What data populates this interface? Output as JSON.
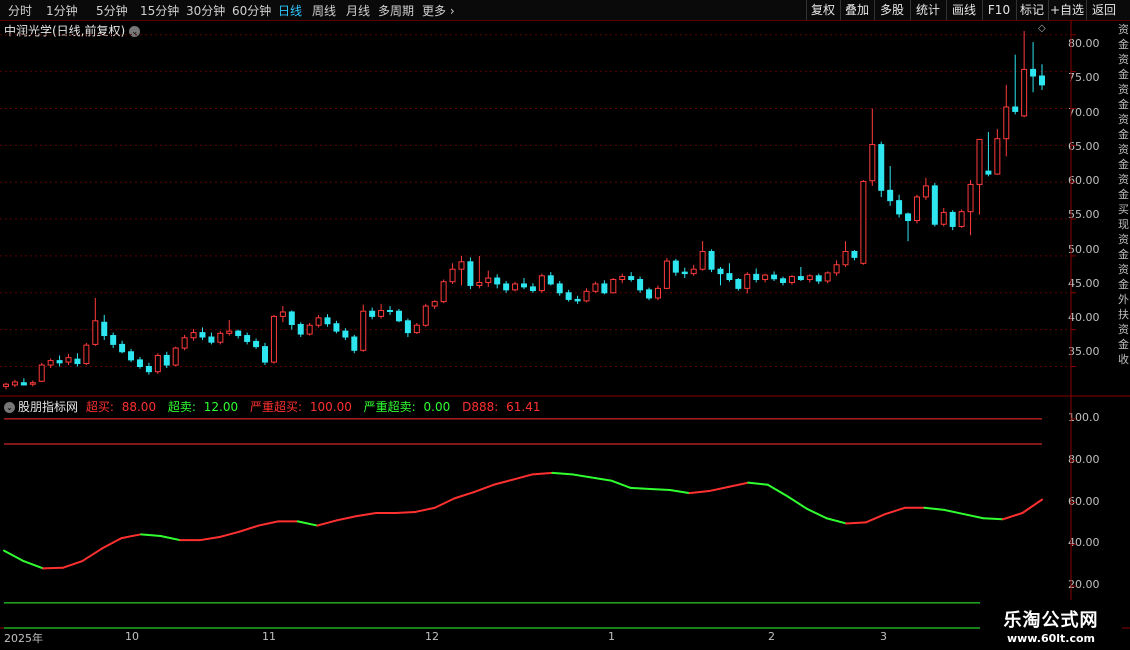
{
  "toolbar": {
    "timeframes": [
      "分时",
      "1分钟",
      "5分钟",
      "15分钟",
      "30分钟",
      "60分钟",
      "日线",
      "周线",
      "月线",
      "多周期",
      "更多"
    ],
    "active_timeframe": "日线",
    "buttons": [
      "复权",
      "叠加",
      "多股",
      "统计",
      "画线",
      "F10",
      "标记",
      "+自选",
      "返回"
    ]
  },
  "stock": {
    "title": "中润光学(日线,前复权)"
  },
  "price_axis": [
    "80.00",
    "75.00",
    "70.00",
    "65.00",
    "60.00",
    "55.00",
    "50.00",
    "45.00",
    "40.00",
    "35.00"
  ],
  "indicator": {
    "name": "股朋指标网",
    "legend": [
      {
        "label": "超买:",
        "value": "88.00",
        "color": "#ff3030"
      },
      {
        "label": "超卖:",
        "value": "12.00",
        "color": "#30ff30"
      },
      {
        "label": "严重超买:",
        "value": "100.00",
        "color": "#ff3030"
      },
      {
        "label": "严重超卖:",
        "value": "0.00",
        "color": "#30ff30"
      },
      {
        "label": "D888:",
        "value": "61.41",
        "color": "#ff3030"
      }
    ],
    "axis": [
      "100.0",
      "80.00",
      "60.00",
      "40.00",
      "20.00"
    ]
  },
  "dates": [
    "2025年",
    "10",
    "11",
    "12",
    "1",
    "2",
    "3"
  ],
  "side_strip": "资金资金资金资金资金资金买现资金资金外扶资金收",
  "watermark": {
    "line1": "乐淘公式网",
    "line2": "www.60lt.com"
  },
  "colors": {
    "up": "#ff3b3b",
    "down": "#2ee6f0",
    "overbought": "#ff3030",
    "oversold": "#30ff30"
  },
  "chart_data": [
    {
      "type": "candlestick",
      "title": "中润光学(日线,前复权)",
      "ylim": [
        31,
        82
      ],
      "candles": [
        [
          32.3,
          32.8,
          31.9,
          32.6
        ],
        [
          32.5,
          33.2,
          32.2,
          32.9
        ],
        [
          32.8,
          33.4,
          32.6,
          32.5
        ],
        [
          32.6,
          33.1,
          32.3,
          32.8
        ],
        [
          33.0,
          35.5,
          32.9,
          35.2
        ],
        [
          35.2,
          36.1,
          34.8,
          35.8
        ],
        [
          35.8,
          36.5,
          35.0,
          35.5
        ],
        [
          35.6,
          36.7,
          35.2,
          36.2
        ],
        [
          36.0,
          36.8,
          35.0,
          35.4
        ],
        [
          35.4,
          38.2,
          35.2,
          37.9
        ],
        [
          38.0,
          44.3,
          37.8,
          41.2
        ],
        [
          41.0,
          42.0,
          38.6,
          39.2
        ],
        [
          39.2,
          39.6,
          37.5,
          38.0
        ],
        [
          38.0,
          38.5,
          36.8,
          37.0
        ],
        [
          37.0,
          37.4,
          35.6,
          35.9
        ],
        [
          35.9,
          36.3,
          34.7,
          35.0
        ],
        [
          35.0,
          35.5,
          33.9,
          34.3
        ],
        [
          34.3,
          36.8,
          34.0,
          36.5
        ],
        [
          36.5,
          37.0,
          34.8,
          35.2
        ],
        [
          35.2,
          37.7,
          35.0,
          37.5
        ],
        [
          37.5,
          39.3,
          37.2,
          38.9
        ],
        [
          38.9,
          40.1,
          38.5,
          39.6
        ],
        [
          39.6,
          40.3,
          38.6,
          39.0
        ],
        [
          39.0,
          39.6,
          38.0,
          38.3
        ],
        [
          38.3,
          39.8,
          38.0,
          39.5
        ],
        [
          39.5,
          41.3,
          39.2,
          39.8
        ],
        [
          39.8,
          40.0,
          38.8,
          39.2
        ],
        [
          39.2,
          39.6,
          38.0,
          38.4
        ],
        [
          38.4,
          38.8,
          37.4,
          37.7
        ],
        [
          37.7,
          38.2,
          35.2,
          35.6
        ],
        [
          35.6,
          42.0,
          35.4,
          41.8
        ],
        [
          41.8,
          43.2,
          41.0,
          42.4
        ],
        [
          42.4,
          42.6,
          40.0,
          40.7
        ],
        [
          40.7,
          41.0,
          39.0,
          39.4
        ],
        [
          39.4,
          40.9,
          39.2,
          40.6
        ],
        [
          40.6,
          42.0,
          40.3,
          41.6
        ],
        [
          41.6,
          42.1,
          40.4,
          40.8
        ],
        [
          40.8,
          41.2,
          39.5,
          39.8
        ],
        [
          39.8,
          40.2,
          38.6,
          39.0
        ],
        [
          39.0,
          39.3,
          36.8,
          37.2
        ],
        [
          37.2,
          43.4,
          37.0,
          42.5
        ],
        [
          42.5,
          43.0,
          41.4,
          41.8
        ],
        [
          41.8,
          43.5,
          41.5,
          42.6
        ],
        [
          42.6,
          43.2,
          42.0,
          42.5
        ],
        [
          42.5,
          42.8,
          41.0,
          41.2
        ],
        [
          41.2,
          41.5,
          39.0,
          39.6
        ],
        [
          39.6,
          40.9,
          39.4,
          40.6
        ],
        [
          40.6,
          43.5,
          40.4,
          43.2
        ],
        [
          43.2,
          44.0,
          42.8,
          43.8
        ],
        [
          43.8,
          46.8,
          43.6,
          46.5
        ],
        [
          46.5,
          49.0,
          46.2,
          48.2
        ],
        [
          48.2,
          50.0,
          46.0,
          49.2
        ],
        [
          49.2,
          49.8,
          45.5,
          46.0
        ],
        [
          46.0,
          50.0,
          45.6,
          46.4
        ],
        [
          46.4,
          48.0,
          45.8,
          47.0
        ],
        [
          47.0,
          47.5,
          45.6,
          46.2
        ],
        [
          46.2,
          46.6,
          45.0,
          45.4
        ],
        [
          45.4,
          46.5,
          45.2,
          46.2
        ],
        [
          46.2,
          47.0,
          45.5,
          45.8
        ],
        [
          45.8,
          46.3,
          45.0,
          45.3
        ],
        [
          45.3,
          47.6,
          45.0,
          47.3
        ],
        [
          47.3,
          47.8,
          46.0,
          46.2
        ],
        [
          46.2,
          46.6,
          44.6,
          45.0
        ],
        [
          45.0,
          45.4,
          43.8,
          44.1
        ],
        [
          44.1,
          44.6,
          43.5,
          43.9
        ],
        [
          43.9,
          45.6,
          43.7,
          45.2
        ],
        [
          45.2,
          46.5,
          45.0,
          46.2
        ],
        [
          46.2,
          46.7,
          44.8,
          45.0
        ],
        [
          45.0,
          47.0,
          44.9,
          46.8
        ],
        [
          46.8,
          47.6,
          46.3,
          47.2
        ],
        [
          47.2,
          47.8,
          46.5,
          46.8
        ],
        [
          46.8,
          47.2,
          45.0,
          45.4
        ],
        [
          45.4,
          45.7,
          44.0,
          44.3
        ],
        [
          44.3,
          46.0,
          44.0,
          45.6
        ],
        [
          45.6,
          49.7,
          45.5,
          49.3
        ],
        [
          49.3,
          49.6,
          47.3,
          47.8
        ],
        [
          47.8,
          48.4,
          47.0,
          47.6
        ],
        [
          47.6,
          48.8,
          47.3,
          48.2
        ],
        [
          48.2,
          52.0,
          48.0,
          50.6
        ],
        [
          50.6,
          50.9,
          47.8,
          48.2
        ],
        [
          48.2,
          48.5,
          46.0,
          47.6
        ],
        [
          47.6,
          49.0,
          46.5,
          46.8
        ],
        [
          46.8,
          47.0,
          45.3,
          45.6
        ],
        [
          45.6,
          47.8,
          44.9,
          47.5
        ],
        [
          47.5,
          48.3,
          46.4,
          46.8
        ],
        [
          46.8,
          47.6,
          46.4,
          47.4
        ],
        [
          47.4,
          47.9,
          46.6,
          46.9
        ],
        [
          46.9,
          47.2,
          46.0,
          46.4
        ],
        [
          46.4,
          47.4,
          46.1,
          47.2
        ],
        [
          47.2,
          48.5,
          46.6,
          46.8
        ],
        [
          46.8,
          47.5,
          46.4,
          47.3
        ],
        [
          47.3,
          47.6,
          46.2,
          46.6
        ],
        [
          46.6,
          47.9,
          46.3,
          47.7
        ],
        [
          47.7,
          49.4,
          47.3,
          48.8
        ],
        [
          48.8,
          52.0,
          48.5,
          50.6
        ],
        [
          50.6,
          50.8,
          49.4,
          49.8
        ],
        [
          49.0,
          60.3,
          48.8,
          60.1
        ],
        [
          60.2,
          70.0,
          59.5,
          65.1
        ],
        [
          65.1,
          65.5,
          58.0,
          58.9
        ],
        [
          58.9,
          62.2,
          56.8,
          57.5
        ],
        [
          57.5,
          58.3,
          55.2,
          55.7
        ],
        [
          55.7,
          55.9,
          52.0,
          54.8
        ],
        [
          54.8,
          58.3,
          54.4,
          58.0
        ],
        [
          58.0,
          60.6,
          57.6,
          59.5
        ],
        [
          59.5,
          59.9,
          54.0,
          54.3
        ],
        [
          54.3,
          56.5,
          54.0,
          55.9
        ],
        [
          55.9,
          56.2,
          53.5,
          54.0
        ],
        [
          54.0,
          56.3,
          53.8,
          56.0
        ],
        [
          56.0,
          60.3,
          52.8,
          59.7
        ],
        [
          59.7,
          62.7,
          55.6,
          65.8
        ],
        [
          61.5,
          66.8,
          60.8,
          61.1
        ],
        [
          61.1,
          67.2,
          61.0,
          65.9
        ],
        [
          65.9,
          73.2,
          63.5,
          70.2
        ],
        [
          70.2,
          77.3,
          69.2,
          69.6
        ],
        [
          69.0,
          80.5,
          68.8,
          75.3
        ],
        [
          75.3,
          79.0,
          72.2,
          74.4
        ],
        [
          74.4,
          76.0,
          72.5,
          73.2
        ]
      ]
    },
    {
      "type": "line",
      "title": "股朋指标网",
      "ylim": [
        0,
        110
      ],
      "levels": {
        "超买": 88.0,
        "超卖": 12.0,
        "严重超买": 100.0,
        "严重超卖": 0.0
      },
      "series": [
        {
          "name": "D888",
          "values": [
            37.0,
            32.0,
            28.5,
            28.8,
            32.0,
            38.0,
            43.0,
            44.8,
            44.0,
            42.0,
            42.0,
            43.5,
            46.0,
            49.0,
            51.0,
            51.0,
            49.0,
            51.5,
            53.5,
            55.0,
            55.0,
            55.5,
            57.5,
            62.0,
            65.0,
            68.5,
            71.0,
            73.5,
            74.2,
            73.5,
            72.0,
            70.5,
            67.0,
            66.5,
            66.0,
            64.5,
            65.5,
            67.5,
            69.5,
            68.5,
            63.0,
            57.0,
            52.5,
            50.0,
            50.5,
            54.5,
            57.5,
            57.5,
            56.5,
            54.5,
            52.5,
            52.0,
            55.0,
            61.4
          ]
        }
      ]
    }
  ]
}
